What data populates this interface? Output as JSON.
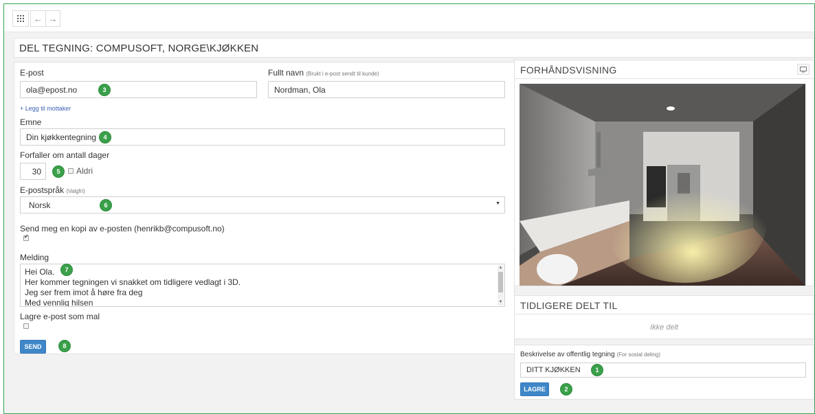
{
  "colors": {
    "badge": "#3aa04a",
    "primary_button": "#3f87c9",
    "frame_border": "#2ea44f",
    "link": "#3a5fb5"
  },
  "toolbar": {
    "apps_icon": "grid-icon",
    "back_icon": "arrow-left-icon",
    "forward_icon": "arrow-right-icon",
    "back_glyph": "←",
    "forward_glyph": "→"
  },
  "page_title": "DEL TEGNING: COMPUSOFT, NORGE\\KJØKKEN",
  "form": {
    "email_label": "E-post",
    "email_value": "ola@epost.no",
    "fullname_label": "Fullt navn",
    "fullname_hint": "(Brukt i e-post sendt til kunde)",
    "fullname_value": "Nordman, Ola",
    "add_recipient": "+ Legg til mottaker",
    "subject_label": "Emne",
    "subject_value": "Din kjøkkentegning",
    "expires_label": "Forfaller om antall dager",
    "expires_value": "30",
    "never_label": "Aldri",
    "never_checked": false,
    "language_label": "E-postspråk",
    "language_hint": "(Valgfri)",
    "language_value": "Norsk",
    "copy_label": "Send meg en kopi av e-posten (henrikb@compusoft.no)",
    "copy_checked": true,
    "message_label": "Melding",
    "message_lines": [
      "Hei Ola.",
      "Her kommer tegningen vi snakket om tidligere vedlagt i 3D.",
      "Jeg ser frem imot å høre fra deg",
      "Med vennlig hilsen"
    ],
    "save_template_label": "Lagre e-post som mal",
    "save_template_checked": false,
    "send_button": "SEND"
  },
  "preview": {
    "title": "FORHÅNDSVISNING",
    "fullscreen_icon": "monitor-icon",
    "image_subject": "kitchen-3d-render"
  },
  "shared": {
    "title": "TIDLIGERE DELT TIL",
    "empty_text": "Ikke delt"
  },
  "public": {
    "label": "Beskrivelse av offentlig tegning",
    "hint": "(For sosial deling)",
    "value": "DITT KJØKKEN",
    "save_button": "LAGRE"
  },
  "badges": [
    "1",
    "2",
    "3",
    "4",
    "5",
    "6",
    "7",
    "8"
  ]
}
